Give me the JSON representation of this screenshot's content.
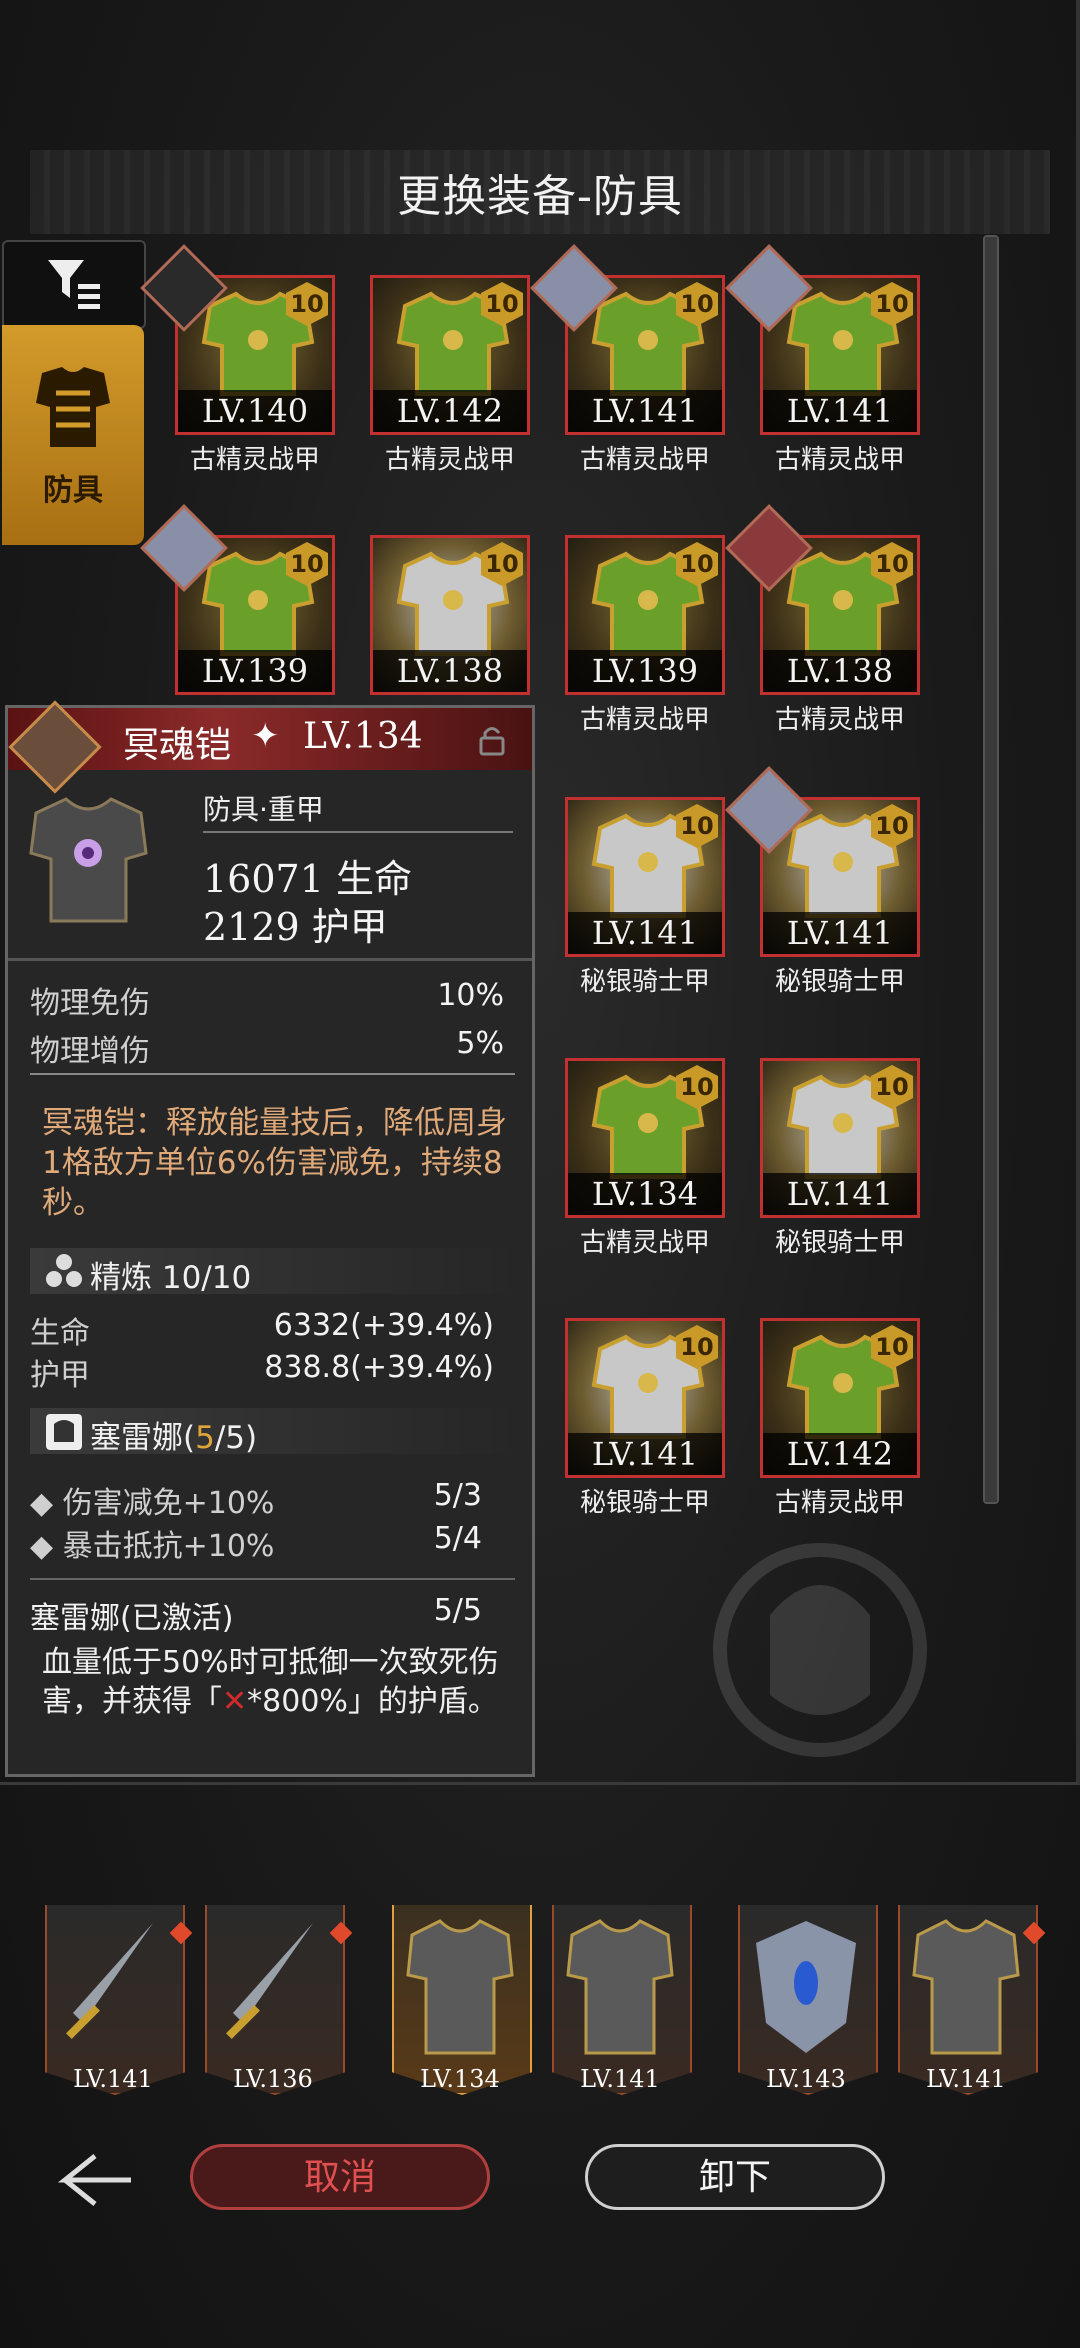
{
  "title": "更换装备-防具",
  "sidebar": {
    "armor_tab_label": "防具"
  },
  "grid": [
    {
      "level": "LV.140",
      "name": "古精灵战甲",
      "kind": "gold",
      "avatar": "dark"
    },
    {
      "level": "LV.142",
      "name": "古精灵战甲",
      "kind": "gold",
      "avatar": ""
    },
    {
      "level": "LV.141",
      "name": "古精灵战甲",
      "kind": "gold",
      "avatar": "light"
    },
    {
      "level": "LV.141",
      "name": "古精灵战甲",
      "kind": "gold",
      "avatar": "light"
    },
    {
      "level": "LV.139",
      "name": "",
      "kind": "gold",
      "avatar": "light"
    },
    {
      "level": "LV.138",
      "name": "",
      "kind": "silver",
      "avatar": ""
    },
    {
      "level": "LV.139",
      "name": "古精灵战甲",
      "kind": "gold",
      "avatar": ""
    },
    {
      "level": "LV.138",
      "name": "古精灵战甲",
      "kind": "gold",
      "avatar": "red"
    },
    {
      "level": "LV.141",
      "name": "秘银骑士甲",
      "kind": "silver",
      "avatar": ""
    },
    {
      "level": "LV.141",
      "name": "秘银骑士甲",
      "kind": "silver",
      "avatar": "light"
    },
    {
      "level": "LV.134",
      "name": "古精灵战甲",
      "kind": "gold",
      "avatar": ""
    },
    {
      "level": "LV.141",
      "name": "秘银骑士甲",
      "kind": "silver",
      "avatar": ""
    },
    {
      "level": "LV.141",
      "name": "秘银骑士甲",
      "kind": "silver",
      "avatar": ""
    },
    {
      "level": "LV.142",
      "name": "古精灵战甲",
      "kind": "gold",
      "avatar": ""
    }
  ],
  "refine_badge": "10",
  "detail": {
    "name": "冥魂铠",
    "level": "LV.134",
    "type": "防具·重甲",
    "stat_hp": "16071 生命",
    "stat_armor": "2129 护甲",
    "rows": [
      {
        "label": "物理免伤",
        "value": "10%"
      },
      {
        "label": "物理增伤",
        "value": "5%"
      }
    ],
    "effect": "冥魂铠：释放能量技后，降低周身1格敌方单位6%伤害减免，持续8秒。",
    "refine_title": "精炼 10/10",
    "refine_rows": [
      {
        "label": "生命",
        "value": "6332(+39.4%)"
      },
      {
        "label": "护甲",
        "value": "838.8(+39.4%)"
      }
    ],
    "set_name": "塞雷娜(",
    "set_count": "5",
    "set_total": "/5)",
    "set_rows": [
      {
        "label": "伤害减免+10%",
        "value": "5/3"
      },
      {
        "label": "暴击抵抗+10%",
        "value": "5/4"
      }
    ],
    "set_active_label": "塞雷娜(已激活)",
    "set_active_value": "5/5",
    "set_desc_a": "血量低于50%时可抵御一次致死伤害，并获得「",
    "set_desc_x": "✕",
    "set_desc_b": "*800%」的护盾。"
  },
  "equipped": [
    {
      "level": "LV.141",
      "icon": "sword-icon"
    },
    {
      "level": "LV.136",
      "icon": "sword-icon"
    },
    {
      "level": "LV.134",
      "icon": "armor-icon"
    },
    {
      "level": "LV.141",
      "icon": "armor-icon"
    },
    {
      "level": "LV.143",
      "icon": "shield-icon"
    },
    {
      "level": "LV.141",
      "icon": "armor-icon"
    }
  ],
  "buttons": {
    "cancel": "取消",
    "unload": "卸下"
  },
  "colors": {
    "accent_gold": "#d39b2a",
    "accent_red": "#c23030",
    "highlight": "#e0a53a"
  }
}
